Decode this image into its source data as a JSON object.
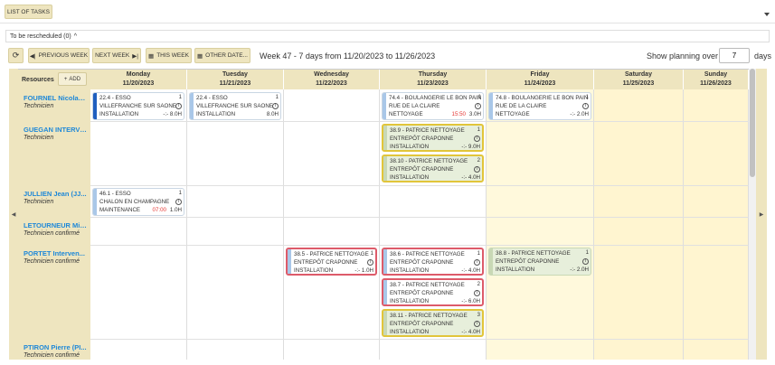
{
  "top": {
    "list_tasks": "LIST OF TASKS"
  },
  "reschedule": {
    "label": "To be rescheduled (0)",
    "caret": "^"
  },
  "toolbar": {
    "refresh": "⟳",
    "prev_week": "PREVIOUS WEEK",
    "next_week": "NEXT WEEK",
    "this_week": "THIS WEEK",
    "other_date": "OTHER DATE...",
    "title": "Week 47 - 7 days from 11/20/2023 to 11/26/2023",
    "show_label": "Show planning over",
    "days_value": "7",
    "days_label": "days"
  },
  "resources_header": {
    "label": "Resources",
    "add": "ADD"
  },
  "days": [
    {
      "name": "Monday",
      "date": "11/20/2023"
    },
    {
      "name": "Tuesday",
      "date": "11/21/2023"
    },
    {
      "name": "Wednesday",
      "date": "11/22/2023"
    },
    {
      "name": "Thursday",
      "date": "11/23/2023"
    },
    {
      "name": "Friday",
      "date": "11/24/2023"
    },
    {
      "name": "Saturday",
      "date": "11/25/2023"
    },
    {
      "name": "Sunday",
      "date": "11/26/2023"
    }
  ],
  "resources": [
    {
      "name": "FOURNEL Nicolas ...",
      "role": "Technicien"
    },
    {
      "name": "GUEGAN INTERVE...",
      "role": "Technicien"
    },
    {
      "name": "JULLIEN Jean (JJ...",
      "role": "Technicien"
    },
    {
      "name": "LETOURNEUR Mic...",
      "role": "Technicien confirmé"
    },
    {
      "name": "PORTET Interven...",
      "role": "Technicien confirmé"
    },
    {
      "name": "PTIRON Pierre (PI...",
      "role": "Technicien confirmé"
    }
  ],
  "cards": [
    {
      "day": 0,
      "row": 0,
      "slot": 0,
      "style": "plain",
      "num": "1",
      "title": "22.4 - ESSO",
      "place": "VILLEFRANCHE SUR SAONE",
      "type": "INSTALLATION",
      "time": "",
      "dur": "-:-  8.0H",
      "accent": "#1f5fbf"
    },
    {
      "day": 1,
      "row": 0,
      "slot": 0,
      "style": "plain",
      "num": "1",
      "title": "22.4 - ESSO",
      "place": "VILLEFRANCHE SUR SAONE",
      "type": "INSTALLATION",
      "time": "",
      "dur": "8.0H",
      "accent": "#a9c7e8"
    },
    {
      "day": 3,
      "row": 0,
      "slot": 0,
      "style": "plain",
      "num": "1",
      "title": "74.4 - BOULANGERIE LE BON PAIN",
      "place": "RUE DE LA CLAIRE",
      "type": "NETTOYAGE",
      "time": "15:50",
      "dur": "3.0H",
      "accent": "#a9c7e8"
    },
    {
      "day": 4,
      "row": 0,
      "slot": 0,
      "style": "plain",
      "num": "1",
      "title": "74.8 - BOULANGERIE LE BON PAIN",
      "place": "RUE DE LA CLAIRE",
      "type": "NETTOYAGE",
      "time": "",
      "dur": "-:-  2.0H",
      "accent": "#a9c7e8"
    },
    {
      "day": 3,
      "row": 1,
      "slot": 0,
      "style": "yellow",
      "num": "1",
      "title": "38.9 - PATRICE NETTOYAGE",
      "place": "ENTREPÔT CRAPONNE",
      "type": "INSTALLATION",
      "time": "",
      "dur": "-:-  9.0H",
      "accent": "#c8d8b5"
    },
    {
      "day": 3,
      "row": 1,
      "slot": 1,
      "style": "yellow",
      "num": "2",
      "title": "38.10 - PATRICE NETTOYAGE",
      "place": "ENTREPÔT CRAPONNE",
      "type": "INSTALLATION",
      "time": "",
      "dur": "-:-  4.0H",
      "accent": "#c8d8b5"
    },
    {
      "day": 0,
      "row": 2,
      "slot": 0,
      "style": "plain",
      "num": "1",
      "title": "46.1 - ESSO",
      "place": "CHALON EN CHAMPAGNE",
      "type": "MAINTENANCE",
      "time": "07:00",
      "dur": "1.0H",
      "accent": "#a9c7e8"
    },
    {
      "day": 2,
      "row": 4,
      "slot": 0,
      "style": "red",
      "num": "1",
      "title": "38.5 - PATRICE NETTOYAGE",
      "place": "ENTREPÔT CRAPONNE",
      "type": "INSTALLATION",
      "time": "",
      "dur": "-:-  1.0H",
      "accent": "#a9c7e8"
    },
    {
      "day": 3,
      "row": 4,
      "slot": 0,
      "style": "red",
      "num": "1",
      "title": "38.6 - PATRICE NETTOYAGE",
      "place": "ENTREPÔT CRAPONNE",
      "type": "INSTALLATION",
      "time": "",
      "dur": "-:-  4.0H",
      "accent": "#a9c7e8"
    },
    {
      "day": 3,
      "row": 4,
      "slot": 1,
      "style": "red",
      "num": "2",
      "title": "38.7 - PATRICE NETTOYAGE",
      "place": "ENTREPÔT CRAPONNE",
      "type": "INSTALLATION",
      "time": "",
      "dur": "-:-  6.0H",
      "accent": "#a9c7e8"
    },
    {
      "day": 3,
      "row": 4,
      "slot": 2,
      "style": "yellow",
      "num": "3",
      "title": "38.11 - PATRICE NETTOYAGE",
      "place": "ENTREPÔT CRAPONNE",
      "type": "INSTALLATION",
      "time": "",
      "dur": "-:-  4.0H",
      "accent": "#c8d8b5"
    },
    {
      "day": 4,
      "row": 4,
      "slot": 0,
      "style": "green",
      "num": "1",
      "title": "38.8 - PATRICE NETTOYAGE",
      "place": "ENTREPÔT CRAPONNE",
      "type": "INSTALLATION",
      "time": "",
      "dur": "-:-  2.0H",
      "accent": "#c8d8b5"
    }
  ],
  "colors": {
    "accent_tan": "#eee5bf",
    "link_blue": "#1e88d8",
    "weekend_yellow": "#fff9dc",
    "today_yellow": "#fff5d0",
    "red_time": "#e53935"
  }
}
